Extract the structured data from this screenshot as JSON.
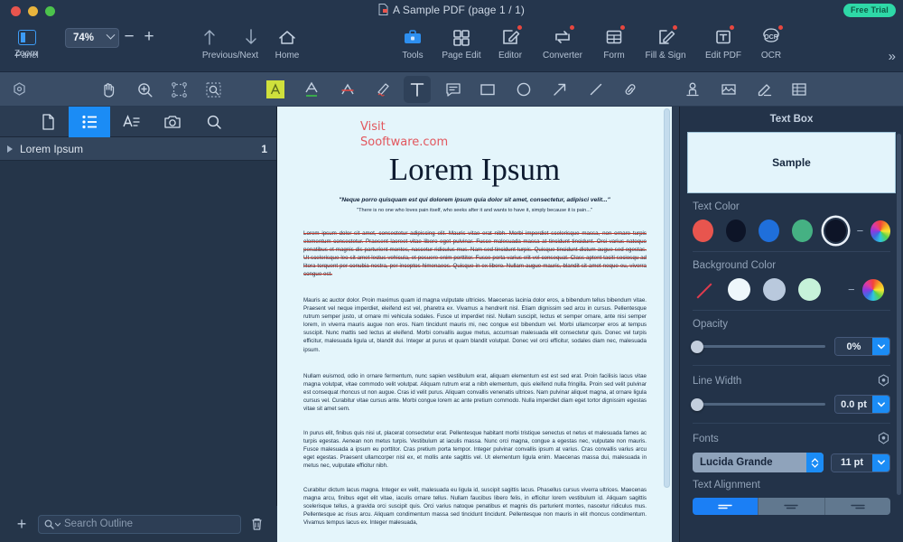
{
  "window": {
    "title": "A Sample PDF (page 1 / 1)",
    "free_trial_badge": "Free Trial",
    "traffic_lights": [
      "close",
      "minimize",
      "maximize"
    ]
  },
  "toolbar": {
    "panel": {
      "label": "Panel",
      "icon": "panel-icon"
    },
    "zoom": {
      "label": "Zoom",
      "value": "74%",
      "minus": "−",
      "plus": "+"
    },
    "prevnext": {
      "label": "Previous/Next",
      "up_icon": "arrow-up-icon",
      "down_icon": "arrow-down-icon"
    },
    "home": {
      "label": "Home",
      "icon": "home-icon"
    },
    "items": [
      {
        "label": "Tools",
        "icon": "toolbox-icon",
        "badge": false
      },
      {
        "label": "Page Edit",
        "icon": "grid-icon",
        "badge": false
      },
      {
        "label": "Editor",
        "icon": "editor-pencil-icon",
        "badge": true
      },
      {
        "label": "Converter",
        "icon": "converter-icon",
        "badge": true
      },
      {
        "label": "Form",
        "icon": "form-table-icon",
        "badge": true
      },
      {
        "label": "Fill & Sign",
        "icon": "fill-sign-icon",
        "badge": true
      },
      {
        "label": "Edit PDF",
        "icon": "edit-pdf-icon",
        "badge": true
      },
      {
        "label": "OCR",
        "icon": "ocr-icon",
        "badge": true
      }
    ],
    "overflow": "»"
  },
  "annotation_toolbar": {
    "tools": [
      {
        "name": "settings-gear-icon",
        "active": false
      },
      {
        "name": "hand-icon",
        "active": false
      },
      {
        "name": "zoom-in-icon",
        "active": false
      },
      {
        "name": "select-area-icon",
        "active": false
      },
      {
        "name": "snapshot-select-icon",
        "active": false
      },
      {
        "name": "highlight-icon",
        "active": false
      },
      {
        "name": "underline-icon",
        "active": false
      },
      {
        "name": "strikethrough-icon",
        "active": false
      },
      {
        "name": "squiggly-icon",
        "active": false
      },
      {
        "name": "text-box-icon",
        "active": true
      },
      {
        "name": "note-comment-icon",
        "active": false
      },
      {
        "name": "rectangle-icon",
        "active": false
      },
      {
        "name": "ellipse-icon",
        "active": false
      },
      {
        "name": "arrow-icon",
        "active": false
      },
      {
        "name": "line-icon",
        "active": false
      },
      {
        "name": "link-icon",
        "active": false
      },
      {
        "name": "stamp-icon",
        "active": false
      },
      {
        "name": "image-icon",
        "active": false
      },
      {
        "name": "signature-icon",
        "active": false
      },
      {
        "name": "table-icon",
        "active": false
      }
    ]
  },
  "sidebar": {
    "tabs": [
      {
        "name": "pages-tab",
        "icon": "page-icon",
        "active": false
      },
      {
        "name": "outline-tab",
        "icon": "outline-list-icon",
        "active": true
      },
      {
        "name": "text-tab",
        "icon": "text-lines-icon",
        "active": false
      },
      {
        "name": "snapshot-tab",
        "icon": "camera-icon",
        "active": false
      },
      {
        "name": "search-tab",
        "icon": "search-icon",
        "active": false
      }
    ],
    "outline": [
      {
        "title": "Lorem Ipsum",
        "page": "1"
      }
    ],
    "footer": {
      "add_label": "+",
      "search_placeholder": "Search Outline",
      "delete_icon": "trash-icon"
    }
  },
  "document": {
    "visit_line1": "Visit",
    "visit_line2": "Sooftware.com",
    "title": "Lorem Ipsum",
    "quote1": "\"Neque porro quisquam est qui dolorem ipsum quia dolor sit amet, consectetur, adipisci velit...\"",
    "quote2": "\"There is no one who loves pain itself, who seeks after it and wants to have it, simply because it is pain...\"",
    "paragraphs": [
      "Lorem ipsum dolor sit amet, consectetur adipiscing elit. Mauris vitae erat nibh. Morbi imperdiet scelerisque massa, non ornare turpis elementum consectetur. Praesent laoreet vitae libero eget pulvinar. Fusce malesuada massa at tincidunt tincidunt. Orci varius natoque penatibus et magnis dis parturient montes, nascetur ridiculus mus. Nam sed tincidunt turpis. Quisque tincidunt dictum augue sed egestas. Ut scelerisque leo sit amet lectus vehicula, et posuere enim porttitor. Fusce porta varius elit vel consequat. Class aptent taciti sociosqu ad litora torquent per conubia nostra, per inceptos himenaeos. Quisque in ex libero. Nullam augue mauris, blandit sit amet neque eu, viverra congue est.",
      "Mauris ac auctor dolor. Proin maximus quam id magna vulputate ultricies. Maecenas lacinia dolor eros, a bibendum tellus bibendum vitae. Praesent vel neque imperdiet, eleifend est vel, pharetra ex. Vivamus a hendrerit nisl. Etiam dignissim sed arcu in cursus. Pellentesque rutrum semper justo, ut ornare mi vehicula sodales. Fusce ut imperdiet nisl. Nullam suscipit, lectus et semper ornare, ante nisi semper lorem, in viverra mauris augue non eros. Nam tincidunt mauris mi, nec congue est bibendum vel. Morbi ullamcorper eros at tempus suscipit. Nunc mattis sed lectus at eleifend. Morbi convallis augue metus, accumsan malesuada elit consectetur quis. Donec vel turpis efficitur, malesuada ligula ut, blandit dui. Integer at purus et quam blandit volutpat. Donec vel orci efficitur, sodales diam nec, malesuada ipsum.",
      "Nullam euismod, odio in ornare fermentum, nunc sapien vestibulum erat, aliquam elementum est est sed erat. Proin facilisis lacus vitae magna volutpat, vitae commodo velit volutpat. Aliquam rutrum erat a nibh elementum, quis eleifend nulla fringilla. Proin sed velit pulvinar est consequat rhoncus ut non augue. Cras id velit purus. Aliquam convallis venenatis ultrices. Nam pulvinar aliquet magna, at ornare ligula cursus vel. Curabitur vitae cursus ante. Morbi congue lorem ac ante pretium commodo. Nulla imperdiet diam eget tortor dignissim egestas vitae sit amet sem.",
      "In purus elit, finibus quis nisi ut, placerat consectetur erat. Pellentesque habitant morbi tristique senectus et netus et malesuada fames ac turpis egestas. Aenean non metus turpis. Vestibulum at iaculis massa. Nunc orci magna, congue a egestas nec, vulputate non mauris. Fusce malesuada a ipsum eu porttitor. Cras pretium porta tempor. Integer pulvinar convallis ipsum at varius. Cras convallis varius arcu eget egestas. Praesent ullamcorper nisl ex, et mollis ante sagittis vel. Ut elementum ligula enim. Maecenas massa dui, malesuada in metus nec, vulputate efficitur nibh.",
      "Curabitur dictum lacus magna. Integer ex velit, malesuada eu ligula id, suscipit sagittis lacus. Phasellus cursus viverra ultrices. Maecenas magna arcu, finibus eget elit vitae, iaculis ornare tellus. Nullam faucibus libero felis, in efficitur lorem vestibulum id. Aliquam sagittis scelerisque tellus, a gravida orci suscipit quis. Orci varius natoque penatibus et magnis dis parturient montes, nascetur ridiculus mus. Pellentesque ac risus arcu. Aliquam condimentum massa sed tincidunt tincidunt. Pellentesque non mauris in elit rhoncus condimentum. Vivamus tempus lacus ex. Integer malesuada,"
    ]
  },
  "right_panel": {
    "title": "Text Box",
    "preview_text": "Sample",
    "text_color": {
      "label": "Text Color",
      "swatches": [
        "#e8554e",
        "#0d1427",
        "#1f6fdb",
        "#45b183"
      ],
      "selected": "#0d1427",
      "more_icon": "color-wheel-icon",
      "minus": "−"
    },
    "background_color": {
      "label": "Background Color",
      "none_label": "none",
      "swatches": [
        "#eef7fb",
        "#b9c9dd",
        "#c6f2d9"
      ],
      "more_icon": "color-wheel-icon",
      "minus": "−"
    },
    "opacity": {
      "label": "Opacity",
      "value": "0%",
      "slider_percent": 0
    },
    "line_width": {
      "label": "Line Width",
      "value": "0.0 pt",
      "slider_percent": 0,
      "reset_icon": "target-icon"
    },
    "fonts": {
      "label": "Fonts",
      "family": "Lucida Grande",
      "size": "11 pt",
      "reset_icon": "target-icon"
    },
    "text_alignment": {
      "label": "Text Alignment",
      "options": [
        "align-left",
        "align-center",
        "align-right"
      ],
      "selected": "align-left"
    }
  }
}
